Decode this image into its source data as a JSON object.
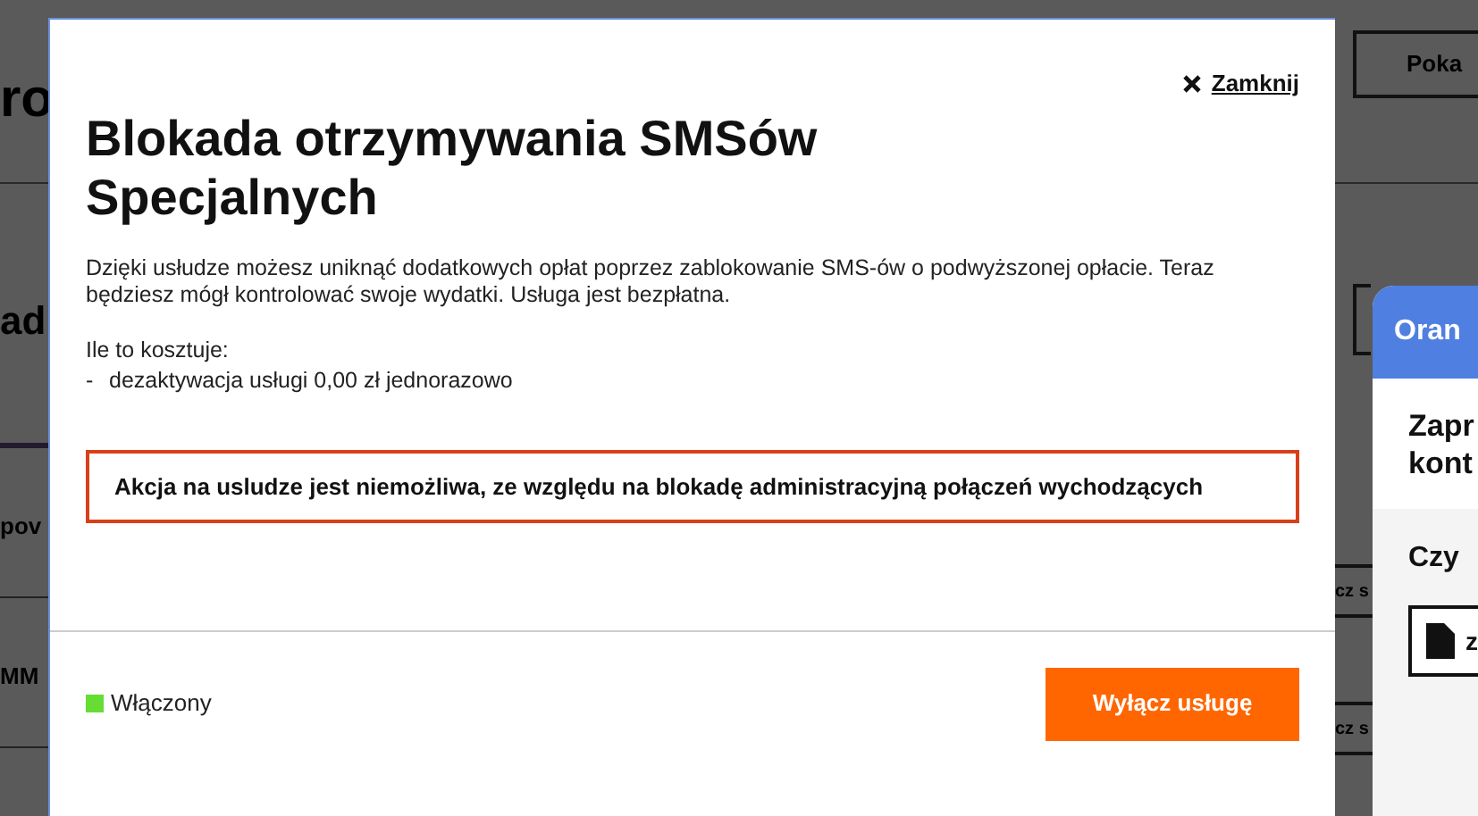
{
  "background": {
    "left_fragments": [
      {
        "kind": "heading",
        "text": "ro"
      },
      {
        "kind": "title",
        "text": "ad"
      },
      {
        "kind": "row",
        "text": "pov"
      },
      {
        "kind": "row",
        "text": "MM"
      }
    ],
    "top_button": "Poka",
    "row_buttons": [
      "cz s",
      "cz s"
    ]
  },
  "dialog": {
    "close_label": "Zamknij",
    "title": "Blokada otrzymywania SMSów Specjalnych",
    "description": "Dzięki usłudze możesz uniknąć dodatkowych opłat poprzez zablokowanie SMS-ów o podwyższonej opłacie. Teraz będziesz mógł kontrolować swoje wydatki. Usługa jest bezpłatna.",
    "cost_heading": "Ile to kosztuje:",
    "cost_items": [
      {
        "marker": "-",
        "text": "dezaktywacja usługi 0,00 zł jednorazowo"
      }
    ],
    "alert": "Akcja na usludze jest niemożliwa, ze względu na blokadę administracyjną połączeń wychodzących",
    "status": {
      "label": "Włączony",
      "active": true
    },
    "action_button": "Wyłącz usługę"
  },
  "chat_panel": {
    "header": "Oran",
    "title_lines": [
      "Zapr",
      "kont"
    ],
    "question": "Czy",
    "option": "z"
  }
}
